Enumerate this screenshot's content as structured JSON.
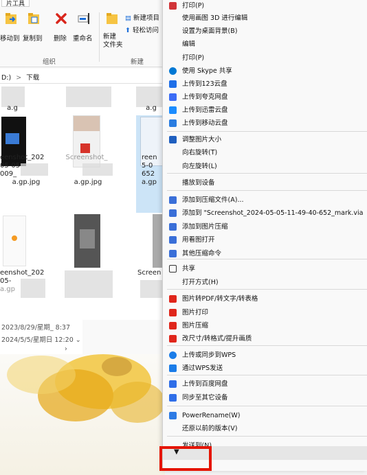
{
  "explorer": {
    "ribbon_tab": "片工具",
    "ribbon_buttons": [
      {
        "label": "移动到"
      },
      {
        "label": "复制到"
      },
      {
        "label": "删除"
      },
      {
        "label": "重命名"
      },
      {
        "label": "新建\n文件夹"
      }
    ],
    "small_buttons": [
      "新建项目",
      "轻松访问"
    ],
    "group_labels": [
      "组织",
      "新建"
    ],
    "address": {
      "drive": "D:)",
      "sep": ">",
      "folder": "下载"
    },
    "files": [
      {
        "name": "a.g"
      },
      {
        "name": "a.g"
      },
      {
        "name": "eenshot_202\n05-05\n009_",
        "ext": "a.gp.jpg"
      },
      {
        "name": "Screenshot_",
        "ext": "a.gp.jpg"
      },
      {
        "name": "reen\n5-0\n652",
        "ext": "a.gp"
      },
      {
        "name": "eenshot_202\n05-",
        "ext": "a.gp"
      },
      {
        "name": "Screen",
        "ext": ""
      }
    ],
    "status_rows": [
      "2023/8/29/星期_ 8:37",
      "2024/5/5/星期日 12:20"
    ]
  },
  "menu": {
    "items": [
      {
        "label": "打印(P)",
        "icon": "print-icon",
        "color": "#d13438"
      },
      {
        "label": "使用画图 3D 进行编辑"
      },
      {
        "label": "设置为桌面背景(B)"
      },
      {
        "label": "编辑"
      },
      {
        "label": "打印(P)"
      },
      {
        "label": "使用 Skype 共享",
        "icon": "skype-icon",
        "color": "#0078d4"
      },
      {
        "label": "上传到123云盘",
        "icon": "cloud123-icon",
        "color": "#1e6fe8"
      },
      {
        "label": "上传到夸克网盘",
        "icon": "quark-icon",
        "color": "#3b6cf6"
      },
      {
        "label": "上传到迅雷云盘",
        "icon": "thunder-icon",
        "color": "#1a8cff"
      },
      {
        "label": "上传到移动云盘",
        "icon": "mobile-cloud-icon",
        "color": "#2a7de1"
      },
      {
        "label": "调整图片大小",
        "icon": "resize-icon",
        "color": "#1f5fbf"
      },
      {
        "label": "向右旋转(T)"
      },
      {
        "label": "向左旋转(L)"
      },
      {
        "label": "播放到设备"
      },
      {
        "label": "添加到压缩文件(A)...",
        "icon": "archive-icon",
        "color": "#3a6fd8"
      },
      {
        "label": "添加到 \"Screenshot_2024-05-05-11-49-40-652_mark.via",
        "icon": "archive-icon",
        "color": "#3a6fd8"
      },
      {
        "label": "添加到图片压缩",
        "icon": "archive-icon",
        "color": "#3a6fd8"
      },
      {
        "label": "用看图打开",
        "icon": "archive-icon",
        "color": "#3a6fd8"
      },
      {
        "label": "其他压缩命令",
        "icon": "archive-icon",
        "color": "#3a6fd8"
      },
      {
        "label": "共享",
        "icon": "share-icon",
        "color": "#333333"
      },
      {
        "label": "打开方式(H)"
      },
      {
        "label": "图片转PDF/转文字/转表格",
        "icon": "wps-icon",
        "color": "#e0261b"
      },
      {
        "label": "图片打印",
        "icon": "wps-icon",
        "color": "#e0261b"
      },
      {
        "label": "图片压缩",
        "icon": "wps-icon",
        "color": "#e0261b"
      },
      {
        "label": "改尺寸/转格式/提升画质",
        "icon": "wps-icon",
        "color": "#e0261b"
      },
      {
        "label": "上传或同步到WPS",
        "icon": "wps-cloud-icon",
        "color": "#1a7ce8"
      },
      {
        "label": "通过WPS发送",
        "icon": "wps-send-icon",
        "color": "#1a7ce8"
      },
      {
        "label": "上传到百度网盘",
        "icon": "baidu-icon",
        "color": "#2f6ee8"
      },
      {
        "label": "同步至其它设备",
        "icon": "baidu-icon",
        "color": "#2f6ee8"
      },
      {
        "label": "PowerRename(W)",
        "icon": "powerrename-icon",
        "color": "#2d7be5"
      },
      {
        "label": "还原以前的版本(V)"
      },
      {
        "label": "发送到(N)"
      }
    ],
    "expand_arrow": "▼",
    "highlight_color": "#e51400"
  }
}
